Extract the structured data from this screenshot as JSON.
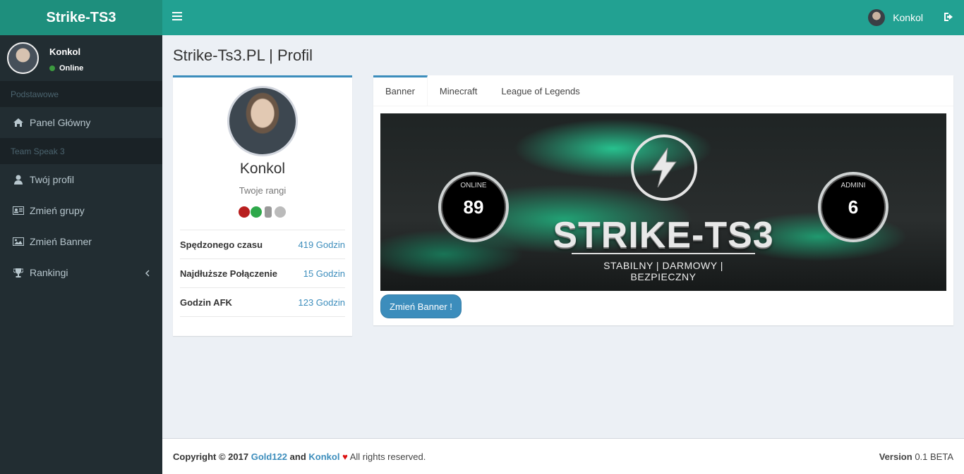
{
  "app": {
    "logo": "Strike-TS3"
  },
  "header": {
    "username": "Konkol"
  },
  "sidebar": {
    "user": {
      "name": "Konkol",
      "status": "Online"
    },
    "sections": [
      {
        "title": "Podstawowe"
      },
      {
        "title": "Team Speak 3"
      }
    ],
    "items": [
      {
        "label": "Panel Główny",
        "icon": "home-icon"
      },
      {
        "label": "Twój profil",
        "icon": "user-icon"
      },
      {
        "label": "Zmień grupy",
        "icon": "id-card-icon"
      },
      {
        "label": "Zmień Banner",
        "icon": "image-icon"
      },
      {
        "label": "Rankingi",
        "icon": "trophy-icon"
      }
    ]
  },
  "page": {
    "title": "Strike-Ts3.PL | Profil"
  },
  "profile": {
    "name": "Konkol",
    "subtitle": "Twoje rangi",
    "stats": [
      {
        "label": "Spędzonego czasu",
        "value": "419 Godzin"
      },
      {
        "label": "Najdłuższe Połączenie",
        "value": "15 Godzin"
      },
      {
        "label": "Godzin AFK",
        "value": "123 Godzin"
      }
    ]
  },
  "tabs": [
    {
      "label": "Banner",
      "active": true
    },
    {
      "label": "Minecraft",
      "active": false
    },
    {
      "label": "League of Legends",
      "active": false
    }
  ],
  "banner": {
    "online_label": "ONLINE",
    "online_value": "89",
    "admins_label": "ADMINI",
    "admins_value": "6",
    "brand": "STRIKE-TS3",
    "tagline": "STABILNY | DARMOWY | BEZPIECZNY",
    "button": "Zmień Banner !"
  },
  "footer": {
    "copyright": "Copyright © 2017",
    "author1": "Gold122",
    "and": "and",
    "author2": "Konkol",
    "rights": "All rights reserved.",
    "version_label": "Version",
    "version_value": "0.1 BETA"
  },
  "colors": {
    "accent": "#3c8dbc",
    "header": "#22a192",
    "logo_bg": "#1e8f7d",
    "sidebar": "#222d32"
  }
}
